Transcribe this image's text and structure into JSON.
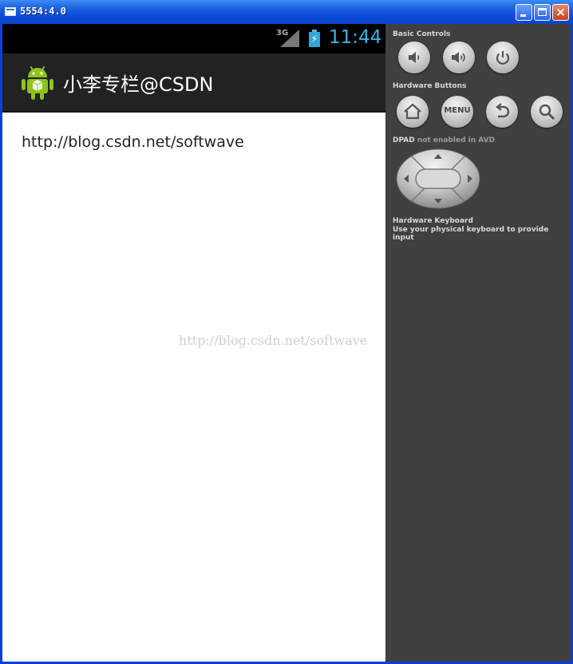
{
  "window": {
    "title": "5554:4.0",
    "close_glyph": "×"
  },
  "status_bar": {
    "network": "3G",
    "time": "11:44",
    "charging_glyph": "⚡"
  },
  "action_bar": {
    "title": "小李专栏@CSDN",
    "app_icon": "android-icon"
  },
  "content": {
    "text": "http://blog.csdn.net/softwave"
  },
  "watermark": "http://blog.csdn.net/softwave",
  "panel": {
    "basic_controls_label": "Basic Controls",
    "hardware_buttons_label": "Hardware Buttons",
    "menu_label": "MENU",
    "dpad_label": "DPAD",
    "dpad_note": "not enabled in AVD",
    "keyboard_label": "Hardware Keyboard",
    "keyboard_note": "Use your physical keyboard to provide input"
  }
}
